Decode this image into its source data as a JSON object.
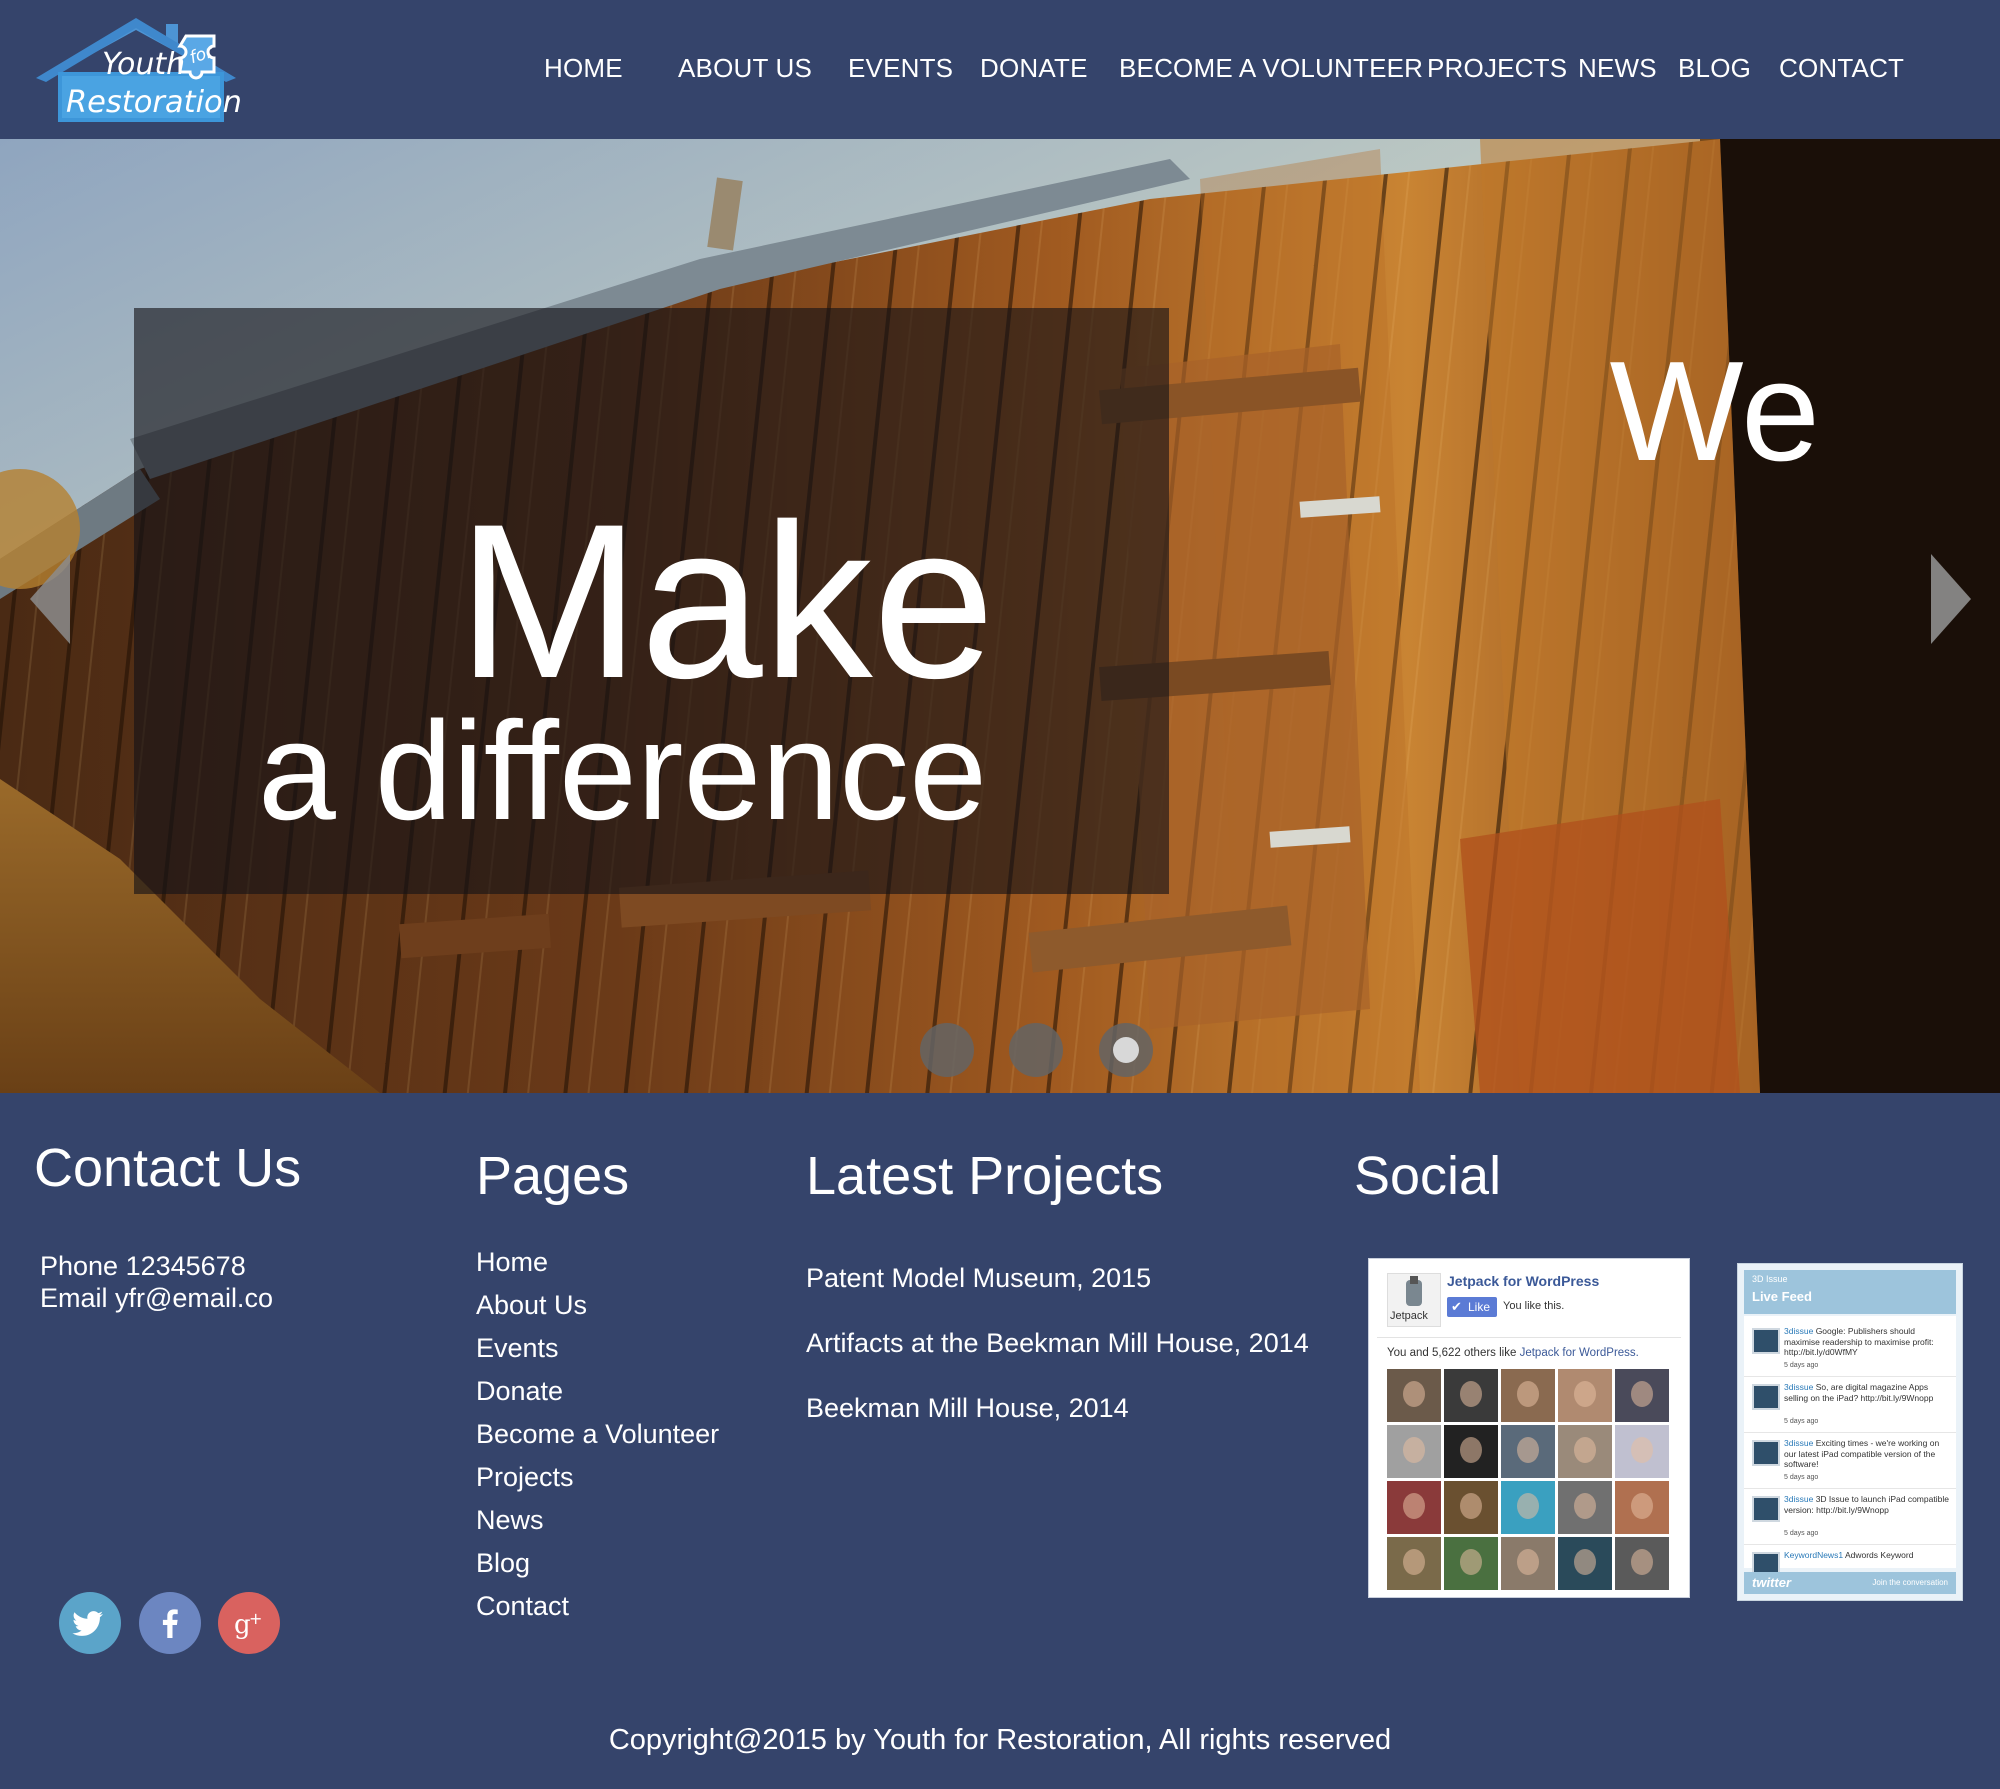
{
  "brand": {
    "logo_line1": "Youth",
    "logo_line2": "for",
    "logo_line3": "Restoration"
  },
  "nav": {
    "items": [
      {
        "label": "HOME"
      },
      {
        "label": "ABOUT US"
      },
      {
        "label": "EVENTS"
      },
      {
        "label": "DONATE"
      },
      {
        "label": "BECOME A VOLUNTEER"
      },
      {
        "label": "PROJECTS"
      },
      {
        "label": "NEWS"
      },
      {
        "label": "BLOG"
      },
      {
        "label": "CONTACT"
      }
    ]
  },
  "hero": {
    "line1": "We",
    "line2": "Make",
    "line3": "a difference",
    "active_slide": 3,
    "slide_count": 3
  },
  "contact": {
    "heading": "Contact Us",
    "phone": "Phone 12345678",
    "email": "Email yfr@email.co"
  },
  "pages": {
    "heading": "Pages",
    "items": [
      {
        "label": "Home"
      },
      {
        "label": "About Us"
      },
      {
        "label": "Events"
      },
      {
        "label": "Donate"
      },
      {
        "label": "Become a Volunteer"
      },
      {
        "label": "Projects"
      },
      {
        "label": "News"
      },
      {
        "label": "Blog"
      },
      {
        "label": "Contact"
      }
    ]
  },
  "projects": {
    "heading": "Latest Projects",
    "items": [
      {
        "label": "Patent Model Museum, 2015"
      },
      {
        "label": "Artifacts at the Beekman Mill House, 2014"
      },
      {
        "label": "Beekman Mill House, 2014"
      }
    ]
  },
  "social": {
    "heading": "Social",
    "facebook_widget": {
      "page_name": "Jetpack for WordPress",
      "logo_label": "Jetpack",
      "like_label": "Like",
      "you_like": "You like this.",
      "likes_prefix": "You and 5,622 others like ",
      "likes_link": "Jetpack for WordPress."
    },
    "twitter_widget": {
      "account": "3D Issue",
      "title": "Live Feed",
      "tweets": [
        {
          "user": "3dissue",
          "text": "Google: Publishers should maximise readership to maximise profit: http://bit.ly/d0WfMY",
          "time": "5 days ago"
        },
        {
          "user": "3dissue",
          "text": "So, are digital magazine Apps selling on the iPad? http://bit.ly/9Wnopp",
          "time": "5 days ago"
        },
        {
          "user": "3dissue",
          "text": "Exciting times - we're working on our latest iPad compatible version of the software!",
          "time": "5 days ago"
        },
        {
          "user": "3dissue",
          "text": "3D Issue to launch iPad compatible version: http://bit.ly/9Wnopp",
          "time": "5 days ago"
        },
        {
          "user": "KeywordNews1",
          "text": "Adwords Keyword",
          "time": ""
        }
      ],
      "brand": "twitter",
      "join": "Join the conversation"
    }
  },
  "footer": {
    "copyright": "Copyright@2015 by Youth for Restoration, All rights reserved"
  },
  "colors": {
    "background": "#35446b",
    "twitter": "#5ba4c9",
    "facebook": "#6c86c1",
    "google_plus": "#d9625f"
  }
}
